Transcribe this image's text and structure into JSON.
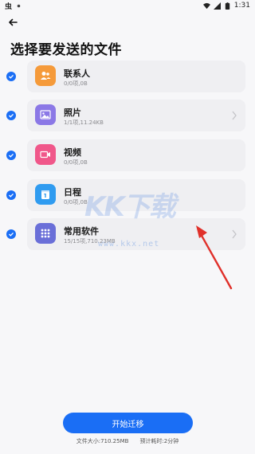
{
  "status_bar": {
    "app_badge": "虫",
    "time": "1:31"
  },
  "page": {
    "title": "选择要发送的文件"
  },
  "items": [
    {
      "label": "联系人",
      "detail": "0/0项,0B",
      "icon": "contacts-icon",
      "color": "#f59a3a",
      "checked": true,
      "has_chevron": false
    },
    {
      "label": "照片",
      "detail": "1/1项,11.24KB",
      "icon": "photo-icon",
      "color": "#8b78e6",
      "checked": true,
      "has_chevron": true
    },
    {
      "label": "视频",
      "detail": "0/0项,0B",
      "icon": "video-icon",
      "color": "#f0578a",
      "checked": true,
      "has_chevron": false
    },
    {
      "label": "日程",
      "detail": "0/0项,0B",
      "icon": "calendar-icon",
      "color": "#2f9bf0",
      "checked": true,
      "has_chevron": false
    },
    {
      "label": "常用软件",
      "detail": "15/15项,710.23MB",
      "icon": "apps-grid-icon",
      "color": "#6a6fd8",
      "checked": true,
      "has_chevron": true
    }
  ],
  "action": {
    "start_label": "开始迁移"
  },
  "footer": {
    "size_label": "文件大小:710.25MB",
    "time_label": "预计耗时:2分钟"
  },
  "watermark": {
    "logo_text": "KK下载",
    "url": "www.kkx.net"
  },
  "colors": {
    "accent": "#1a6ef5",
    "annotation_arrow": "#e0302a"
  }
}
